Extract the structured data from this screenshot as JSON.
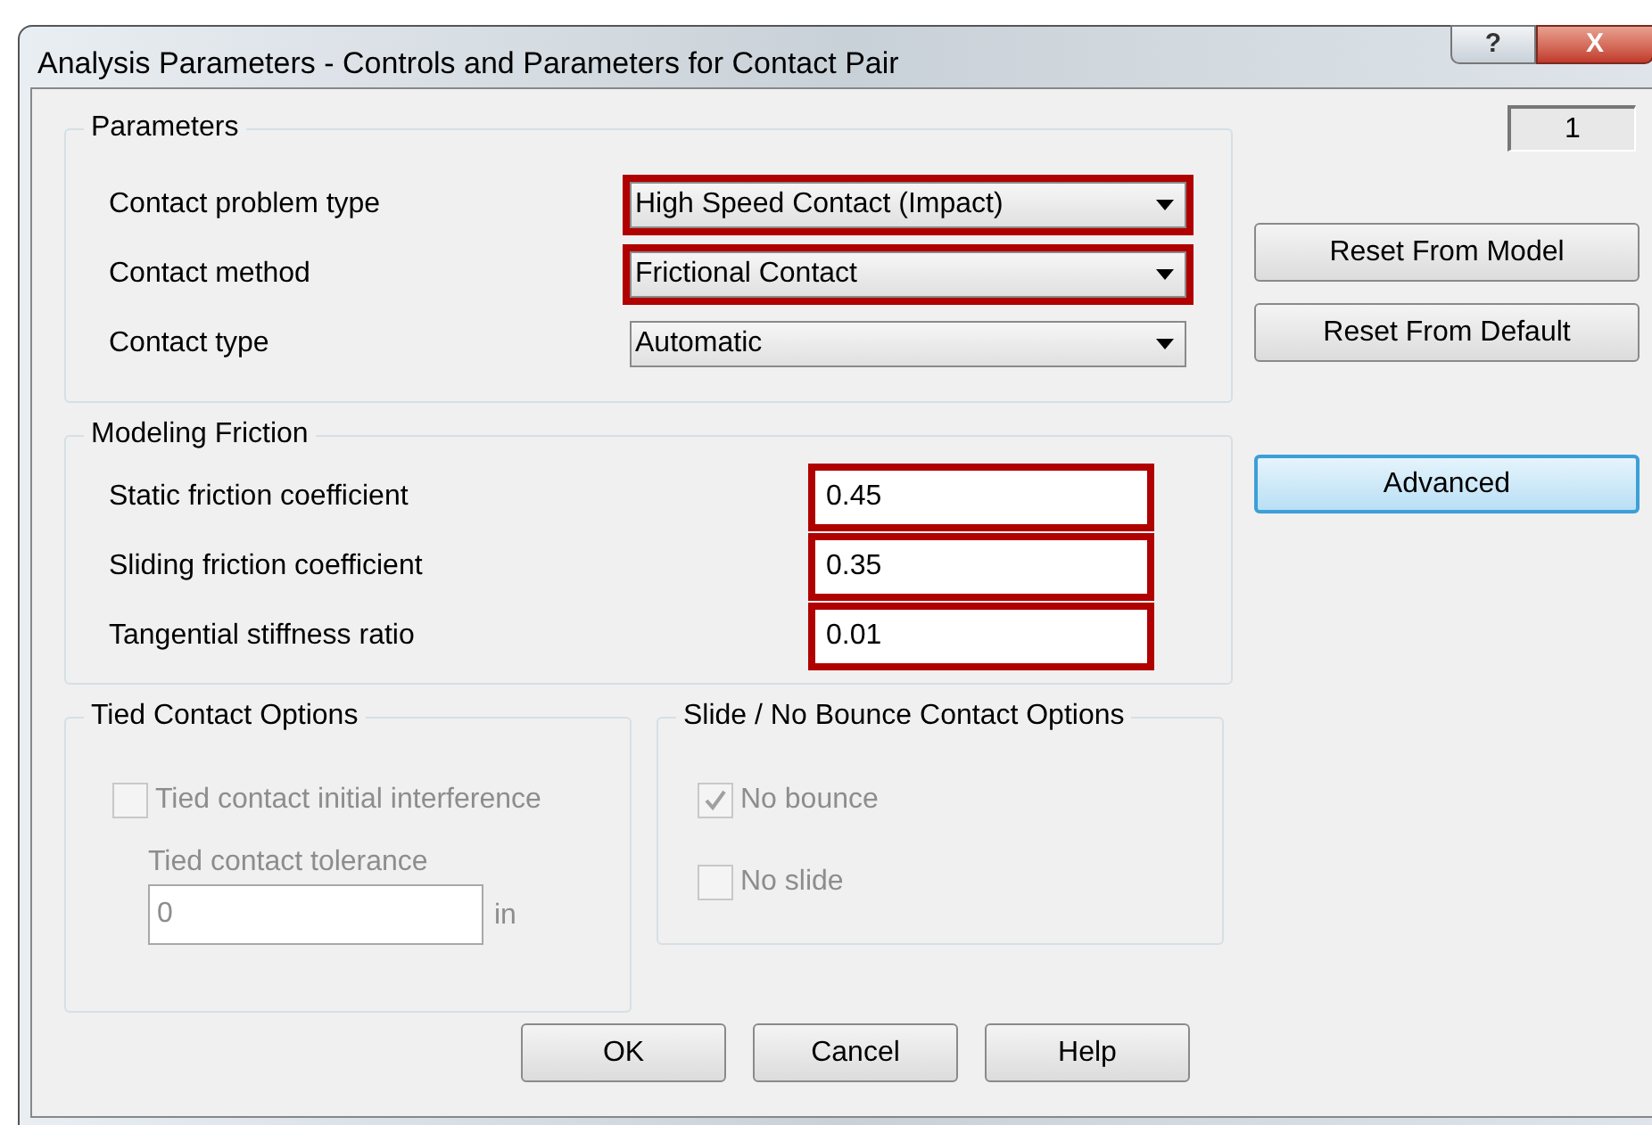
{
  "window": {
    "title": "Analysis Parameters - Controls and Parameters for Contact Pair",
    "buttons": [
      {
        "kind": "help",
        "label": "?"
      },
      {
        "kind": "close",
        "label": "X"
      }
    ]
  },
  "counter": "1",
  "parameters": {
    "title": "Parameters",
    "rows": [
      {
        "label": "Contact problem type",
        "value": "High Speed Contact (Impact)",
        "highlighted": true
      },
      {
        "label": "Contact method",
        "value": "Frictional Contact",
        "highlighted": true
      },
      {
        "label": "Contact type",
        "value": "Automatic",
        "highlighted": false
      }
    ]
  },
  "modeling_friction": {
    "title": "Modeling Friction",
    "rows": [
      {
        "label": "Static friction coefficient",
        "value": "0.45",
        "highlighted": true
      },
      {
        "label": "Sliding friction coefficient",
        "value": "0.35",
        "highlighted": true
      },
      {
        "label": "Tangential stiffness ratio",
        "value": "0.01",
        "highlighted": true
      }
    ]
  },
  "tied_contact_options": {
    "title": "Tied Contact Options",
    "checkbox": {
      "label": "Tied contact initial interference",
      "checked": false,
      "disabled": true
    },
    "tolerance": {
      "label": "Tied contact tolerance",
      "value": "0",
      "unit": "in",
      "disabled": true
    }
  },
  "slide_options": {
    "title": "Slide / No Bounce Contact Options",
    "checkboxes": [
      {
        "label": "No bounce",
        "checked": true,
        "disabled": true
      },
      {
        "label": "No slide",
        "checked": false,
        "disabled": true
      }
    ]
  },
  "side_buttons": [
    {
      "label": "Reset From Model",
      "focused": false
    },
    {
      "label": "Reset From Default",
      "focused": false
    },
    {
      "label": "Advanced",
      "focused": true
    }
  ],
  "buttons": [
    "OK",
    "Cancel",
    "Help"
  ]
}
